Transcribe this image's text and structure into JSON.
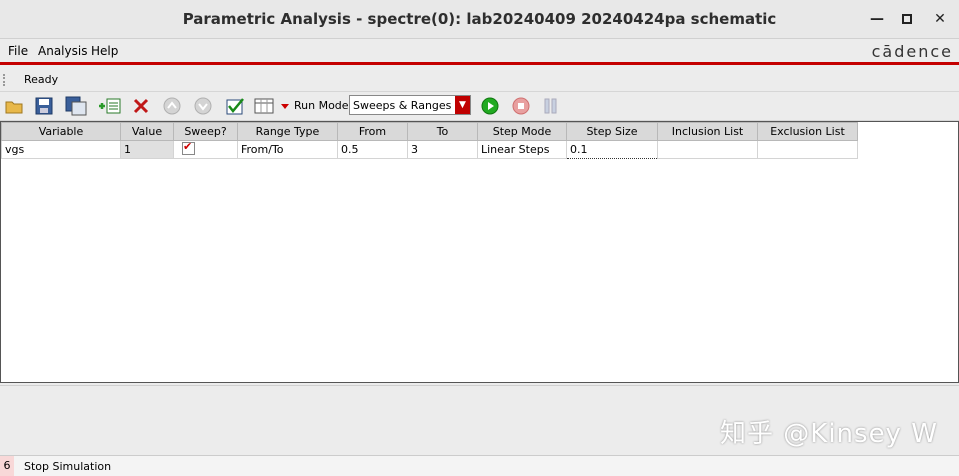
{
  "window": {
    "title": "Parametric Analysis - spectre(0): lab20240409 20240424pa schematic",
    "controls": [
      "close-icon",
      "maximize-icon",
      "minimize-icon"
    ]
  },
  "menu": {
    "file_label": "File",
    "analysis_label": "Analysis",
    "help_label": "Help",
    "logo_text": "cādence"
  },
  "status": {
    "text": "Ready"
  },
  "toolbar": {
    "run_mode_label": "Run Mode:",
    "run_mode_value": "Sweeps & Ranges",
    "icons": [
      "open-folder-icon",
      "save-icon",
      "save-as-icon",
      "add-variable-icon",
      "delete-icon",
      "move-up-icon",
      "move-down-icon",
      "check-icon",
      "table-view-icon",
      "dropdown-icon",
      "run-icon",
      "stop-icon",
      "pause-icon"
    ]
  },
  "table": {
    "headers": [
      "Variable",
      "Value",
      "Sweep?",
      "Range Type",
      "From",
      "To",
      "Step Mode",
      "Step Size",
      "Inclusion List",
      "Exclusion List"
    ],
    "rows": [
      {
        "variable": "vgs",
        "value": "1",
        "sweep": true,
        "range_type": "From/To",
        "from": "0.5",
        "to": "3",
        "step_mode": "Linear Steps",
        "step_size": "0.1",
        "inclusion": "",
        "exclusion": ""
      }
    ]
  },
  "watermark": "知乎 @Kinsey W",
  "bottom": {
    "line_number": "6",
    "text": "Stop Simulation"
  },
  "colors": {
    "accent_red": "#c40000",
    "run_green": "#22aa22",
    "stop_red": "#e06060"
  }
}
